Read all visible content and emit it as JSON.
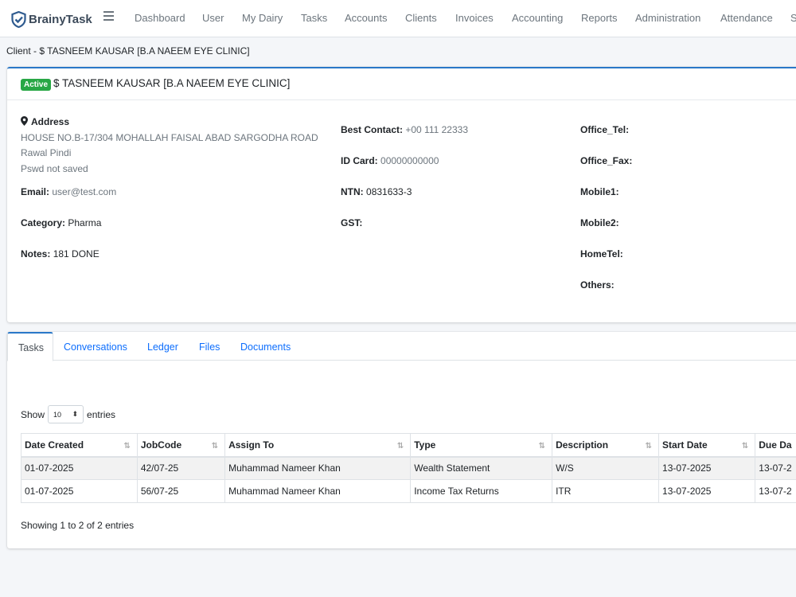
{
  "brand": {
    "name": "BrainyTask"
  },
  "nav": {
    "items": [
      "Dashboard",
      "User",
      "My Dairy",
      "Tasks",
      "Accounts",
      "Clients",
      "Invoices",
      "Accounting",
      "Reports",
      "Administration",
      "Attendance",
      "S"
    ]
  },
  "breadcrumb": "Client - $ TASNEEM KAUSAR [B.A NAEEM EYE CLINIC]",
  "client": {
    "status": "Active",
    "title": "$ TASNEEM KAUSAR [B.A NAEEM EYE CLINIC]",
    "address_label": "Address",
    "address_line1": "HOUSE NO.B-17/304 MOHALLAH FAISAL ABAD SARGODHA ROAD",
    "address_line2": "Rawal Pindi",
    "pswd_note": "Pswd not saved",
    "email_label": "Email:",
    "email_value": "user@test.com",
    "category_label": "Category:",
    "category_value": "Pharma",
    "notes_label": "Notes:",
    "notes_value": "181 DONE",
    "best_contact_label": "Best Contact:",
    "best_contact_value": "+00 111 22333",
    "id_card_label": "ID Card:",
    "id_card_value": "00000000000",
    "ntn_label": "NTN:",
    "ntn_value": "0831633-3",
    "gst_label": "GST:",
    "office_tel_label": "Office_Tel:",
    "office_fax_label": "Office_Fax:",
    "mobile1_label": "Mobile1:",
    "mobile2_label": "Mobile2:",
    "hometel_label": "HomeTel:",
    "others_label": "Others:"
  },
  "tabs": [
    "Tasks",
    "Conversations",
    "Ledger",
    "Files",
    "Documents"
  ],
  "table": {
    "show_label": "Show",
    "page_size": "10",
    "entries_label": "entries",
    "columns": [
      "Date Created",
      "JobCode",
      "Assign To",
      "Type",
      "Description",
      "Start Date",
      "Due Da"
    ],
    "rows": [
      [
        "01-07-2025",
        "42/07-25",
        "Muhammad Nameer Khan",
        "Wealth Statement",
        "W/S",
        "13-07-2025",
        "13-07-2"
      ],
      [
        "01-07-2025",
        "56/07-25",
        "Muhammad Nameer Khan",
        "Income Tax Returns",
        "ITR",
        "13-07-2025",
        "13-07-2"
      ]
    ],
    "info": "Showing 1 to 2 of 2 entries"
  },
  "colors": {
    "accent": "#2a78c8",
    "active_badge": "#28a745",
    "link": "#0d6efd"
  }
}
